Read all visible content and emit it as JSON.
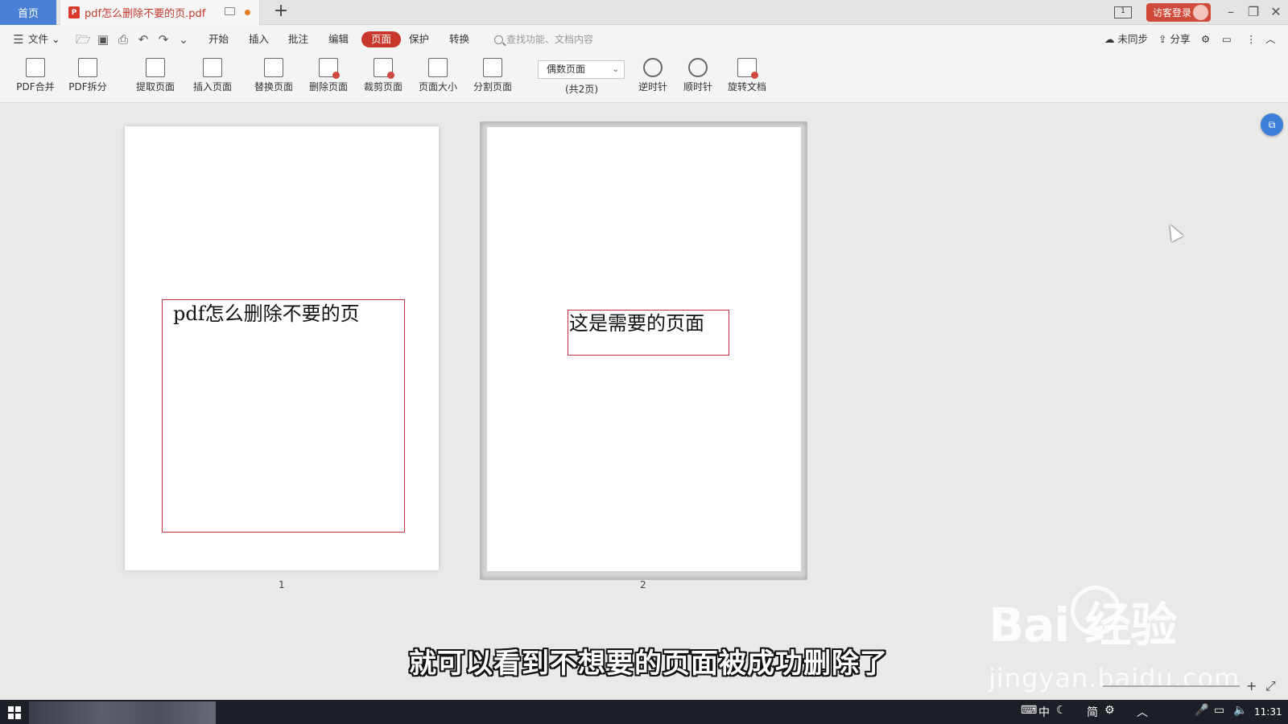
{
  "titlebar": {
    "home_tab": "首页",
    "doc_tab": "pdf怎么删除不要的页.pdf",
    "pdf_badge": "P",
    "new_tab": "+",
    "login": "访客登录"
  },
  "menubar": {
    "file": "文件",
    "tabs": [
      "开始",
      "插入",
      "批注",
      "编辑",
      "页面",
      "保护",
      "转换"
    ],
    "active_tab": "页面",
    "search_placeholder": "查找功能、文档内容",
    "unsynced": "未同步",
    "share": "分享"
  },
  "ribbon": {
    "pdf_merge": "PDF合并",
    "pdf_split": "PDF拆分",
    "extract": "提取页面",
    "insert": "插入页面",
    "replace": "替换页面",
    "delete": "删除页面",
    "crop": "裁剪页面",
    "size": "页面大小",
    "split_page": "分割页面",
    "page_select": "偶数页面",
    "page_count": "(共2页)",
    "ccw": "逆时针",
    "cw": "顺时针",
    "rotate_doc": "旋转文档"
  },
  "pages": {
    "page1_text": "pdf怎么删除不要的页",
    "page2_text": "这是需要的页面",
    "page1_num": "1",
    "page2_num": "2"
  },
  "overlay": {
    "subtitle": "就可以看到不想要的页面被成功删除了",
    "watermark": "Bai  经验",
    "watermark_url": "jingyan.baidu.com"
  },
  "taskbar": {
    "tray": "中",
    "ime": "简",
    "clock": "11:31"
  },
  "colors": {
    "accent": "#c9372c",
    "home_tab": "#4a7fd6",
    "page_box": "#c8323c"
  }
}
